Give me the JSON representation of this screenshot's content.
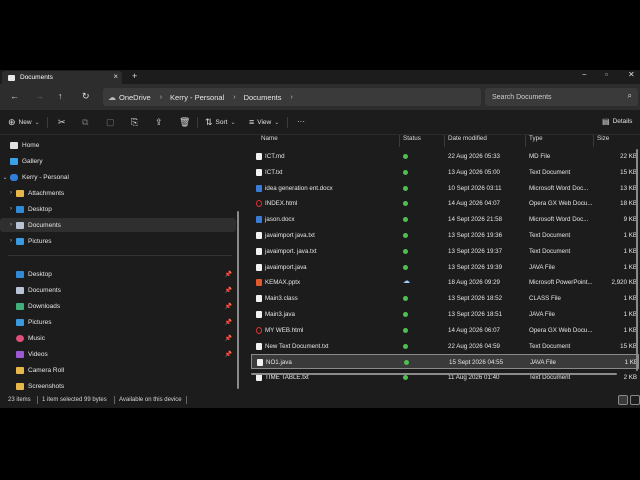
{
  "tab": {
    "title": "Documents",
    "close": "×",
    "new": "+"
  },
  "window_controls": {
    "minimize": "−",
    "maximize": "▫",
    "close": "✕"
  },
  "nav": {
    "back": "←",
    "forward": "→",
    "up": "↑",
    "refresh": "↻"
  },
  "breadcrumb": [
    {
      "label": "OneDrive"
    },
    {
      "label": "Kerry - Personal"
    },
    {
      "label": "Documents"
    }
  ],
  "search": {
    "placeholder": "Search Documents"
  },
  "toolbar": {
    "new_label": "New",
    "sort_label": "Sort",
    "view_label": "View",
    "more_label": "···",
    "details_label": "Details"
  },
  "sidebar": {
    "home": "Home",
    "gallery": "Gallery",
    "onedrive": "Kerry - Personal",
    "attachments": "Attachments",
    "desktop_od": "Desktop",
    "documents_od": "Documents",
    "pictures_od": "Pictures",
    "pinned": [
      {
        "label": "Desktop"
      },
      {
        "label": "Documents"
      },
      {
        "label": "Downloads"
      },
      {
        "label": "Pictures"
      },
      {
        "label": "Music"
      },
      {
        "label": "Videos"
      },
      {
        "label": "Camera Roll"
      },
      {
        "label": "Screenshots"
      }
    ]
  },
  "columns": {
    "name": "Name",
    "status": "Status",
    "date": "Date modified",
    "type": "Type",
    "size": "Size"
  },
  "files": [
    {
      "name": "ICT.md",
      "date": "22 Aug 2026 05:33",
      "type": "MD File",
      "size": "22 KB",
      "icon": "file-icon",
      "status": "synced"
    },
    {
      "name": "ICT.txt",
      "date": "13 Aug 2026 05:00",
      "type": "Text Document",
      "size": "15 KB",
      "icon": "file-icon",
      "status": "synced"
    },
    {
      "name": "idea generation ent.docx",
      "date": "10 Sept 2026 03:11",
      "type": "Microsoft Word Doc...",
      "size": "13 KB",
      "icon": "word-icon",
      "status": "synced"
    },
    {
      "name": "INDEX.html",
      "date": "14 Aug 2026 04:07",
      "type": "Opera GX Web Docu...",
      "size": "18 KB",
      "icon": "opera-icon",
      "status": "synced"
    },
    {
      "name": "jason.docx",
      "date": "14 Sept 2026 21:58",
      "type": "Microsoft Word Doc...",
      "size": "9 KB",
      "icon": "word-icon",
      "status": "synced"
    },
    {
      "name": "javaimport java.txt",
      "date": "13 Sept 2026 19:36",
      "type": "Text Document",
      "size": "1 KB",
      "icon": "file-icon",
      "status": "synced"
    },
    {
      "name": "javaimport. java.txt",
      "date": "13 Sept 2026 19:37",
      "type": "Text Document",
      "size": "1 KB",
      "icon": "file-icon",
      "status": "synced"
    },
    {
      "name": "javaimport.java",
      "date": "13 Sept 2026 19:39",
      "type": "JAVA File",
      "size": "1 KB",
      "icon": "file-icon",
      "status": "synced"
    },
    {
      "name": "KEMAX.pptx",
      "date": "18 Aug 2026 09:29",
      "type": "Microsoft PowerPoint...",
      "size": "2,920 KB",
      "icon": "powerpoint-icon",
      "status": "cloud"
    },
    {
      "name": "Main3.class",
      "date": "13 Sept 2026 18:52",
      "type": "CLASS File",
      "size": "1 KB",
      "icon": "file-icon",
      "status": "synced"
    },
    {
      "name": "Main3.java",
      "date": "13 Sept 2026 18:51",
      "type": "JAVA File",
      "size": "1 KB",
      "icon": "file-icon",
      "status": "synced"
    },
    {
      "name": "MY WEB.html",
      "date": "14 Aug 2026 06:07",
      "type": "Opera GX Web Docu...",
      "size": "1 KB",
      "icon": "opera-icon",
      "status": "synced"
    },
    {
      "name": "New Text Document.txt",
      "date": "22 Aug 2026 04:59",
      "type": "Text Document",
      "size": "15 KB",
      "icon": "file-icon",
      "status": "synced"
    },
    {
      "name": "NO1.java",
      "date": "15 Sept 2026 04:55",
      "type": "JAVA File",
      "size": "1 KB",
      "icon": "file-icon",
      "status": "synced",
      "selected": true
    },
    {
      "name": "TIME TABLE.txt",
      "date": "11 Aug 2026 01:40",
      "type": "Text Document",
      "size": "2 KB",
      "icon": "file-icon",
      "status": "synced"
    }
  ],
  "status_bar": {
    "count": "23 items",
    "selection": "1 item selected  99 bytes",
    "availability": "Available on this device"
  },
  "colors": {
    "accent": "#4fbf4f",
    "selected_row": "#3a3a3a",
    "window_bg": "#1c1c1c"
  }
}
